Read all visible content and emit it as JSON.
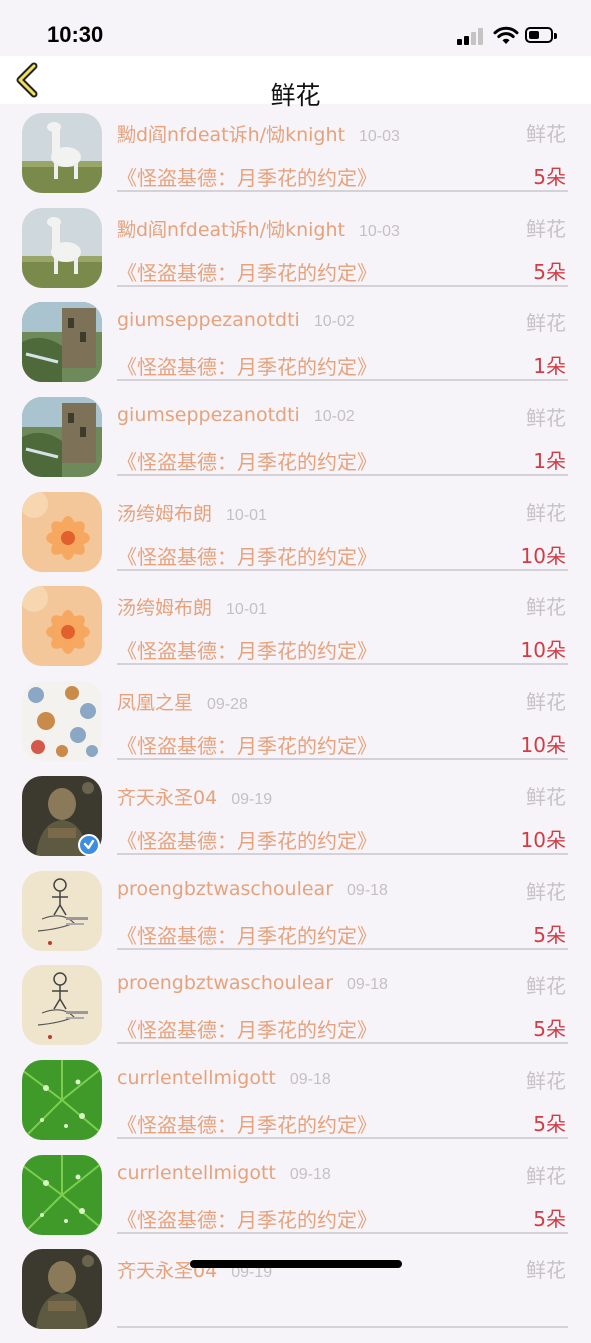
{
  "status_bar": {
    "time": "10:30"
  },
  "nav": {
    "title": "鲜花",
    "back_icon": "chevron-left-icon"
  },
  "rows": [
    {
      "username": "黝d阎nfdeat诉h/恸knight",
      "date": "10-03",
      "gift_type": "鲜花",
      "gift_title": "《怪盗基德：月季花的约定》",
      "count": "5朵",
      "avatar": "llama",
      "verified": false
    },
    {
      "username": "黝d阎nfdeat诉h/恸knight",
      "date": "10-03",
      "gift_type": "鲜花",
      "gift_title": "《怪盗基德：月季花的约定》",
      "count": "5朵",
      "avatar": "llama",
      "verified": false
    },
    {
      "username": "giumseppezanotdti",
      "date": "10-02",
      "gift_type": "鲜花",
      "gift_title": "《怪盗基德：月季花的约定》",
      "count": "1朵",
      "avatar": "ruins",
      "verified": false
    },
    {
      "username": "giumseppezanotdti",
      "date": "10-02",
      "gift_type": "鲜花",
      "gift_title": "《怪盗基德：月季花的约定》",
      "count": "1朵",
      "avatar": "ruins",
      "verified": false
    },
    {
      "username": "汤绔姆布朗",
      "date": "10-01",
      "gift_type": "鲜花",
      "gift_title": "《怪盗基德：月季花的约定》",
      "count": "10朵",
      "avatar": "flower",
      "verified": false
    },
    {
      "username": "汤绔姆布朗",
      "date": "10-01",
      "gift_type": "鲜花",
      "gift_title": "《怪盗基德：月季花的约定》",
      "count": "10朵",
      "avatar": "flower",
      "verified": false
    },
    {
      "username": "凤凰之星",
      "date": "09-28",
      "gift_type": "鲜花",
      "gift_title": "《怪盗基德：月季花的约定》",
      "count": "10朵",
      "avatar": "cartoon",
      "verified": false
    },
    {
      "username": "齐天永圣04",
      "date": "09-19",
      "gift_type": "鲜花",
      "gift_title": "《怪盗基德：月季花的约定》",
      "count": "10朵",
      "avatar": "warrior",
      "verified": true
    },
    {
      "username": "proengbztwaschoulear",
      "date": "09-18",
      "gift_type": "鲜花",
      "gift_title": "《怪盗基德：月季花的约定》",
      "count": "5朵",
      "avatar": "sketch",
      "verified": false
    },
    {
      "username": "proengbztwaschoulear",
      "date": "09-18",
      "gift_type": "鲜花",
      "gift_title": "《怪盗基德：月季花的约定》",
      "count": "5朵",
      "avatar": "sketch",
      "verified": false
    },
    {
      "username": "currlentellmigott",
      "date": "09-18",
      "gift_type": "鲜花",
      "gift_title": "《怪盗基德：月季花的约定》",
      "count": "5朵",
      "avatar": "leaf",
      "verified": false
    },
    {
      "username": "currlentellmigott",
      "date": "09-18",
      "gift_type": "鲜花",
      "gift_title": "《怪盗基德：月季花的约定》",
      "count": "5朵",
      "avatar": "leaf",
      "verified": false
    },
    {
      "username": "齐天永圣04",
      "date": "09-19",
      "gift_type": "鲜花",
      "gift_title": "",
      "count": "",
      "avatar": "warrior",
      "verified": false
    }
  ],
  "colors": {
    "accent": "#e6a27c",
    "count": "#d33c45",
    "muted": "#c6c2c6"
  }
}
